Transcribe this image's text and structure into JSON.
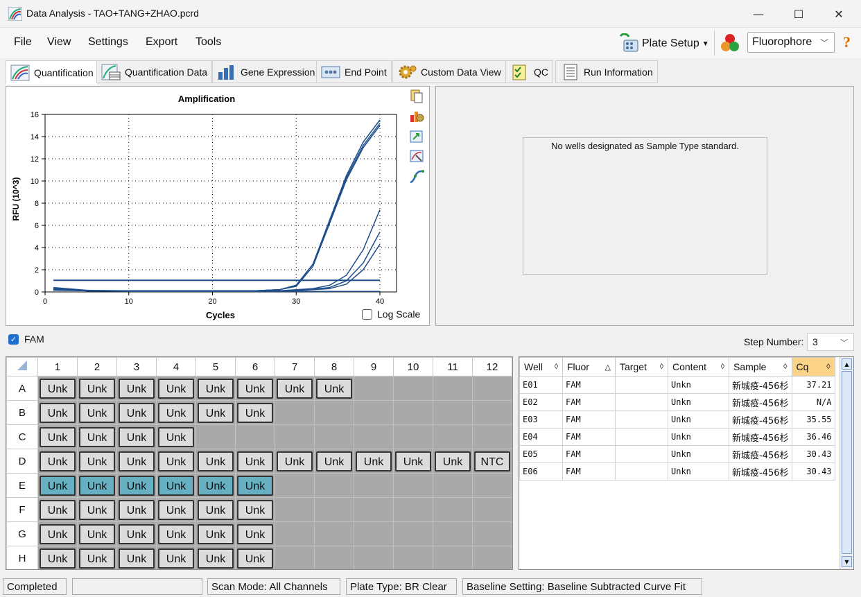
{
  "window": {
    "title": "Data Analysis - TAO+TANG+ZHAO.pcrd",
    "minimize": "—",
    "maximize": "☐",
    "close": "✕"
  },
  "menu": {
    "file": "File",
    "view": "View",
    "settings": "Settings",
    "export": "Export",
    "tools": "Tools",
    "plate_setup": "Plate Setup",
    "fluorophore_value": "Fluorophore",
    "help_icon": "?"
  },
  "tabs": [
    {
      "label": "Quantification",
      "icon": "amplification-icon"
    },
    {
      "label": "Quantification Data",
      "icon": "data-icon"
    },
    {
      "label": "Gene Expression",
      "icon": "bar-chart-icon"
    },
    {
      "label": "End Point",
      "icon": "endpoint-icon"
    },
    {
      "label": "Custom Data View",
      "icon": "gear-icon"
    },
    {
      "label": "QC",
      "icon": "checklist-icon"
    },
    {
      "label": "Run Information",
      "icon": "document-icon"
    }
  ],
  "chart_data": {
    "type": "line",
    "title": "Amplification",
    "xlabel": "Cycles",
    "ylabel": "RFU (10^3)",
    "xlim": [
      0,
      40
    ],
    "ylim": [
      0,
      16
    ],
    "xticks": [
      0,
      10,
      20,
      30,
      40
    ],
    "yticks": [
      0,
      2,
      4,
      6,
      8,
      10,
      12,
      14,
      16
    ],
    "grid": true,
    "threshold": 1.05,
    "x": [
      1,
      5,
      10,
      15,
      20,
      25,
      28,
      30,
      32,
      34,
      36,
      38,
      40
    ],
    "series": [
      {
        "values": [
          0.4,
          0.15,
          0.1,
          0.1,
          0.1,
          0.1,
          0.2,
          0.6,
          2.5,
          6.5,
          10.5,
          13.5,
          15.5
        ]
      },
      {
        "values": [
          0.3,
          0.1,
          0.1,
          0.1,
          0.1,
          0.1,
          0.2,
          0.6,
          2.5,
          6.4,
          10.3,
          13.2,
          15.2
        ]
      },
      {
        "values": [
          0.35,
          0.1,
          0.1,
          0.1,
          0.1,
          0.1,
          0.2,
          0.5,
          2.3,
          6.2,
          10.1,
          13.0,
          15.0
        ]
      },
      {
        "values": [
          0.3,
          0.1,
          0.1,
          0.1,
          0.1,
          0.1,
          0.1,
          0.2,
          0.3,
          0.6,
          1.5,
          3.8,
          7.4
        ]
      },
      {
        "values": [
          0.25,
          0.1,
          0.1,
          0.1,
          0.1,
          0.1,
          0.1,
          0.15,
          0.25,
          0.4,
          1.0,
          2.6,
          5.4
        ]
      },
      {
        "values": [
          0.2,
          0.1,
          0.1,
          0.1,
          0.1,
          0.1,
          0.1,
          0.1,
          0.2,
          0.3,
          0.7,
          2.0,
          4.3
        ]
      },
      {
        "values": [
          0.15,
          0.1,
          0.05,
          0.05,
          0.05,
          0.05,
          0.05,
          0.05,
          0.05,
          0.05,
          0.05,
          0.05,
          0.05
        ]
      }
    ],
    "log_scale_label": "Log Scale"
  },
  "standard_message": "No wells designated as Sample Type standard.",
  "fam_label": "FAM",
  "step_number": {
    "label": "Step Number:",
    "value": "3"
  },
  "plate": {
    "columns": [
      "1",
      "2",
      "3",
      "4",
      "5",
      "6",
      "7",
      "8",
      "9",
      "10",
      "11",
      "12"
    ],
    "rows": [
      {
        "label": "A",
        "wells": [
          "Unk",
          "Unk",
          "Unk",
          "Unk",
          "Unk",
          "Unk",
          "Unk",
          "Unk",
          "",
          "",
          "",
          ""
        ]
      },
      {
        "label": "B",
        "wells": [
          "Unk",
          "Unk",
          "Unk",
          "Unk",
          "Unk",
          "Unk",
          "",
          "",
          "",
          "",
          "",
          ""
        ]
      },
      {
        "label": "C",
        "wells": [
          "Unk",
          "Unk",
          "Unk",
          "Unk",
          "",
          "",
          "",
          "",
          "",
          "",
          "",
          ""
        ]
      },
      {
        "label": "D",
        "wells": [
          "Unk",
          "Unk",
          "Unk",
          "Unk",
          "Unk",
          "Unk",
          "Unk",
          "Unk",
          "Unk",
          "Unk",
          "Unk",
          "NTC"
        ]
      },
      {
        "label": "E",
        "wells": [
          "Unk",
          "Unk",
          "Unk",
          "Unk",
          "Unk",
          "Unk",
          "",
          "",
          "",
          "",
          "",
          ""
        ],
        "selected": true
      },
      {
        "label": "F",
        "wells": [
          "Unk",
          "Unk",
          "Unk",
          "Unk",
          "Unk",
          "Unk",
          "",
          "",
          "",
          "",
          "",
          ""
        ]
      },
      {
        "label": "G",
        "wells": [
          "Unk",
          "Unk",
          "Unk",
          "Unk",
          "Unk",
          "Unk",
          "",
          "",
          "",
          "",
          "",
          ""
        ]
      },
      {
        "label": "H",
        "wells": [
          "Unk",
          "Unk",
          "Unk",
          "Unk",
          "Unk",
          "Unk",
          "",
          "",
          "",
          "",
          "",
          ""
        ]
      }
    ]
  },
  "results": {
    "headers": [
      "Well",
      "Fluor",
      "Target",
      "Content",
      "Sample",
      "Cq"
    ],
    "rows": [
      {
        "well": "E01",
        "fluor": "FAM",
        "target": "",
        "content": "Unkn",
        "sample": "新城疫-456杉",
        "cq": "37.21"
      },
      {
        "well": "E02",
        "fluor": "FAM",
        "target": "",
        "content": "Unkn",
        "sample": "新城疫-456杉",
        "cq": "N/A"
      },
      {
        "well": "E03",
        "fluor": "FAM",
        "target": "",
        "content": "Unkn",
        "sample": "新城疫-456杉",
        "cq": "35.55"
      },
      {
        "well": "E04",
        "fluor": "FAM",
        "target": "",
        "content": "Unkn",
        "sample": "新城疫-456杉",
        "cq": "36.46"
      },
      {
        "well": "E05",
        "fluor": "FAM",
        "target": "",
        "content": "Unkn",
        "sample": "新城疫-456杉",
        "cq": "30.43"
      },
      {
        "well": "E06",
        "fluor": "FAM",
        "target": "",
        "content": "Unkn",
        "sample": "新城疫-456杉",
        "cq": "30.43"
      }
    ]
  },
  "status": {
    "state": "Completed",
    "scan_mode": "Scan Mode: All Channels",
    "plate_type": "Plate Type: BR Clear",
    "baseline": "Baseline Setting: Baseline Subtracted Curve Fit"
  },
  "colors": {
    "curve": "#1f4e8c",
    "selected_well": "#66b0c2",
    "cq_header": "#fcd489",
    "checkbox": "#1f6fd0"
  }
}
